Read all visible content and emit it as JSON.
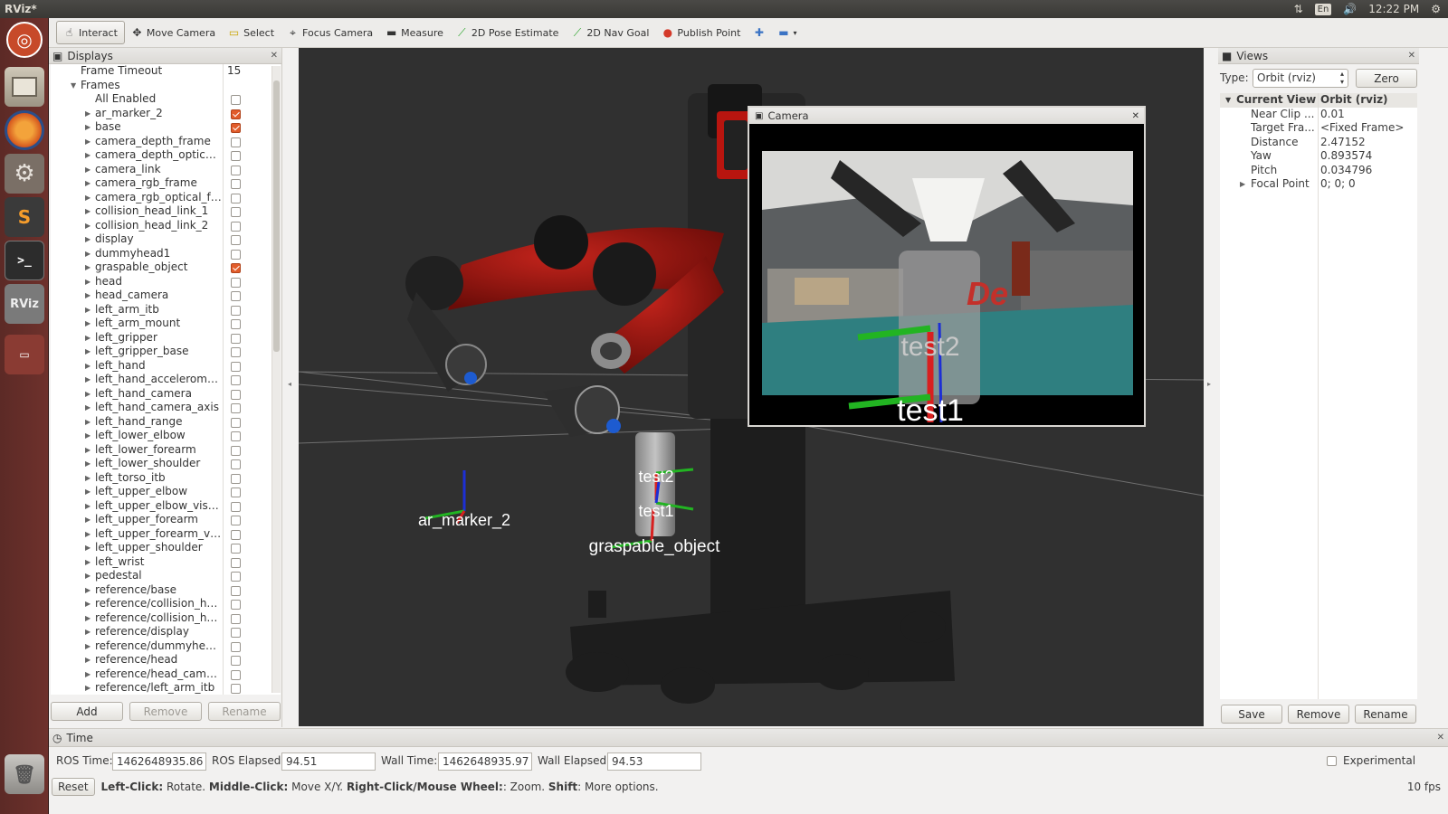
{
  "topbar": {
    "app_title": "RViz*",
    "keyboard": "En",
    "clock": "12:22 PM"
  },
  "toolbar": {
    "tools": [
      "Interact",
      "Move Camera",
      "Select",
      "Focus Camera",
      "Measure",
      "2D Pose Estimate",
      "2D Nav Goal",
      "Publish Point"
    ]
  },
  "displays": {
    "title": "Displays",
    "frame_timeout_label": "Frame Timeout",
    "frame_timeout_value": "15",
    "frames_label": "Frames",
    "all_enabled_label": "All Enabled",
    "frames": [
      {
        "name": "ar_marker_2",
        "checked": true
      },
      {
        "name": "base",
        "checked": true
      },
      {
        "name": "camera_depth_frame",
        "checked": false
      },
      {
        "name": "camera_depth_optical_...",
        "checked": false
      },
      {
        "name": "camera_link",
        "checked": false
      },
      {
        "name": "camera_rgb_frame",
        "checked": false
      },
      {
        "name": "camera_rgb_optical_fra...",
        "checked": false
      },
      {
        "name": "collision_head_link_1",
        "checked": false
      },
      {
        "name": "collision_head_link_2",
        "checked": false
      },
      {
        "name": "display",
        "checked": false
      },
      {
        "name": "dummyhead1",
        "checked": false
      },
      {
        "name": "graspable_object",
        "checked": true
      },
      {
        "name": "head",
        "checked": false
      },
      {
        "name": "head_camera",
        "checked": false
      },
      {
        "name": "left_arm_itb",
        "checked": false
      },
      {
        "name": "left_arm_mount",
        "checked": false
      },
      {
        "name": "left_gripper",
        "checked": false
      },
      {
        "name": "left_gripper_base",
        "checked": false
      },
      {
        "name": "left_hand",
        "checked": false
      },
      {
        "name": "left_hand_accelerometer",
        "checked": false
      },
      {
        "name": "left_hand_camera",
        "checked": false
      },
      {
        "name": "left_hand_camera_axis",
        "checked": false
      },
      {
        "name": "left_hand_range",
        "checked": false
      },
      {
        "name": "left_lower_elbow",
        "checked": false
      },
      {
        "name": "left_lower_forearm",
        "checked": false
      },
      {
        "name": "left_lower_shoulder",
        "checked": false
      },
      {
        "name": "left_torso_itb",
        "checked": false
      },
      {
        "name": "left_upper_elbow",
        "checked": false
      },
      {
        "name": "left_upper_elbow_visual",
        "checked": false
      },
      {
        "name": "left_upper_forearm",
        "checked": false
      },
      {
        "name": "left_upper_forearm_vis...",
        "checked": false
      },
      {
        "name": "left_upper_shoulder",
        "checked": false
      },
      {
        "name": "left_wrist",
        "checked": false
      },
      {
        "name": "pedestal",
        "checked": false
      },
      {
        "name": "reference/base",
        "checked": false
      },
      {
        "name": "reference/collision_hea...",
        "checked": false
      },
      {
        "name": "reference/collision_hea...",
        "checked": false
      },
      {
        "name": "reference/display",
        "checked": false
      },
      {
        "name": "reference/dummyhead1",
        "checked": false
      },
      {
        "name": "reference/head",
        "checked": false
      },
      {
        "name": "reference/head_camera",
        "checked": false
      },
      {
        "name": "reference/left_arm_itb",
        "checked": false
      }
    ],
    "buttons": {
      "add": "Add",
      "remove": "Remove",
      "rename": "Rename"
    }
  },
  "viewport": {
    "labels": {
      "ar_marker": "ar_marker_2",
      "test2": "test2",
      "test1": "test1",
      "graspable": "graspable_object"
    }
  },
  "camera": {
    "title": "Camera",
    "overlay_test2": "test2",
    "overlay_test1": "test1"
  },
  "views": {
    "title": "Views",
    "type_label": "Type:",
    "type_value": "Orbit (rviz)",
    "zero_label": "Zero",
    "current_view_label": "Current View",
    "current_view_value": "Orbit (rviz)",
    "properties": [
      {
        "key": "Near Clip ...",
        "value": "0.01"
      },
      {
        "key": "Target Fra...",
        "value": "<Fixed Frame>"
      },
      {
        "key": "Distance",
        "value": "2.47152"
      },
      {
        "key": "Yaw",
        "value": "0.893574"
      },
      {
        "key": "Pitch",
        "value": "0.034796"
      },
      {
        "key": "Focal Point",
        "value": "0; 0; 0"
      }
    ],
    "buttons": {
      "save": "Save",
      "remove": "Remove",
      "rename": "Rename"
    }
  },
  "time": {
    "title": "Time",
    "ros_time_label": "ROS Time:",
    "ros_time": "1462648935.86",
    "ros_elapsed_label": "ROS Elapsed:",
    "ros_elapsed": "94.51",
    "wall_time_label": "Wall Time:",
    "wall_time": "1462648935.97",
    "wall_elapsed_label": "Wall Elapsed:",
    "wall_elapsed": "94.53",
    "experimental_label": "Experimental"
  },
  "status": {
    "reset_label": "Reset",
    "k1": "Left-Click:",
    "t1": " Rotate. ",
    "k2": "Middle-Click:",
    "t2": " Move X/Y. ",
    "k3": "Right-Click/Mouse Wheel:",
    "t3": ": Zoom. ",
    "k4": "Shift",
    "t4": ": More options.",
    "fps": "10 fps"
  }
}
